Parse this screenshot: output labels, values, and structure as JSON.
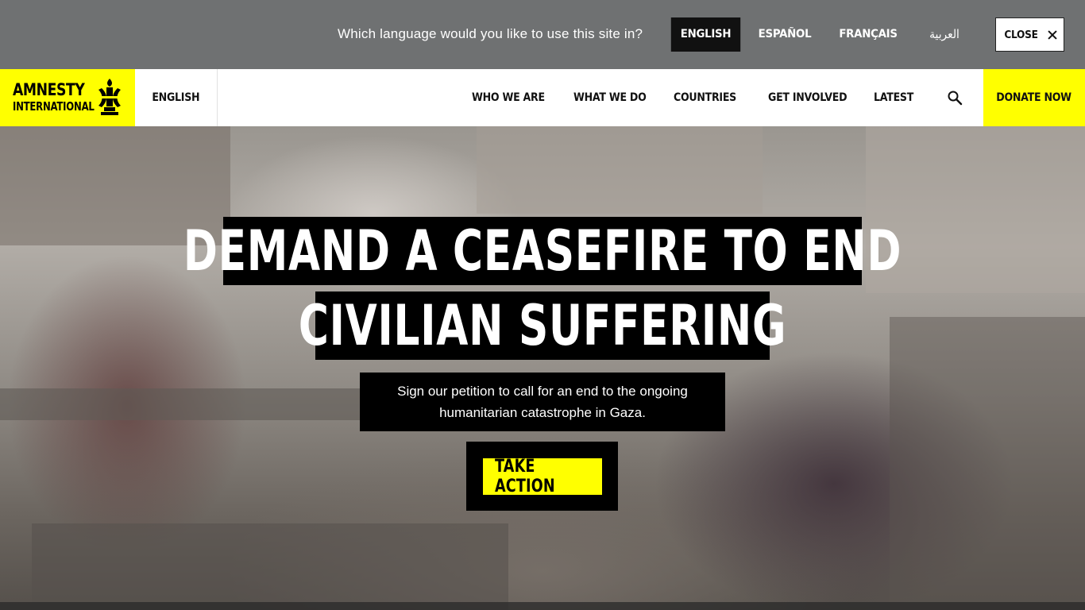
{
  "language_bar": {
    "question": "Which language would you like to use this site in?",
    "options": [
      {
        "label": "ENGLISH",
        "active": true
      },
      {
        "label": "ESPAÑOL",
        "active": false
      },
      {
        "label": "FRANÇAIS",
        "active": false
      },
      {
        "label": "العربية",
        "active": false
      }
    ],
    "close_label": "CLOSE"
  },
  "header": {
    "logo_line1": "AMNESTY",
    "logo_line2": "INTERNATIONAL",
    "current_language": "ENGLISH",
    "nav": [
      "WHO WE ARE",
      "WHAT WE DO",
      "COUNTRIES",
      "GET INVOLVED",
      "LATEST"
    ],
    "donate_label": "DONATE NOW"
  },
  "hero": {
    "headline_line1": "DEMAND A CEASEFIRE TO END",
    "headline_line2": "CIVILIAN SUFFERING",
    "subtext_line1": "Sign our petition to call for an end to the ongoing",
    "subtext_line2": "humanitarian catastrophe in Gaza.",
    "cta_label": "TAKE ACTION"
  },
  "colors": {
    "brand_yellow": "#ffff00",
    "language_bar_bg": "#6f7172",
    "black": "#000000"
  },
  "icons": [
    "close-icon",
    "candle-logo-icon",
    "search-icon"
  ]
}
